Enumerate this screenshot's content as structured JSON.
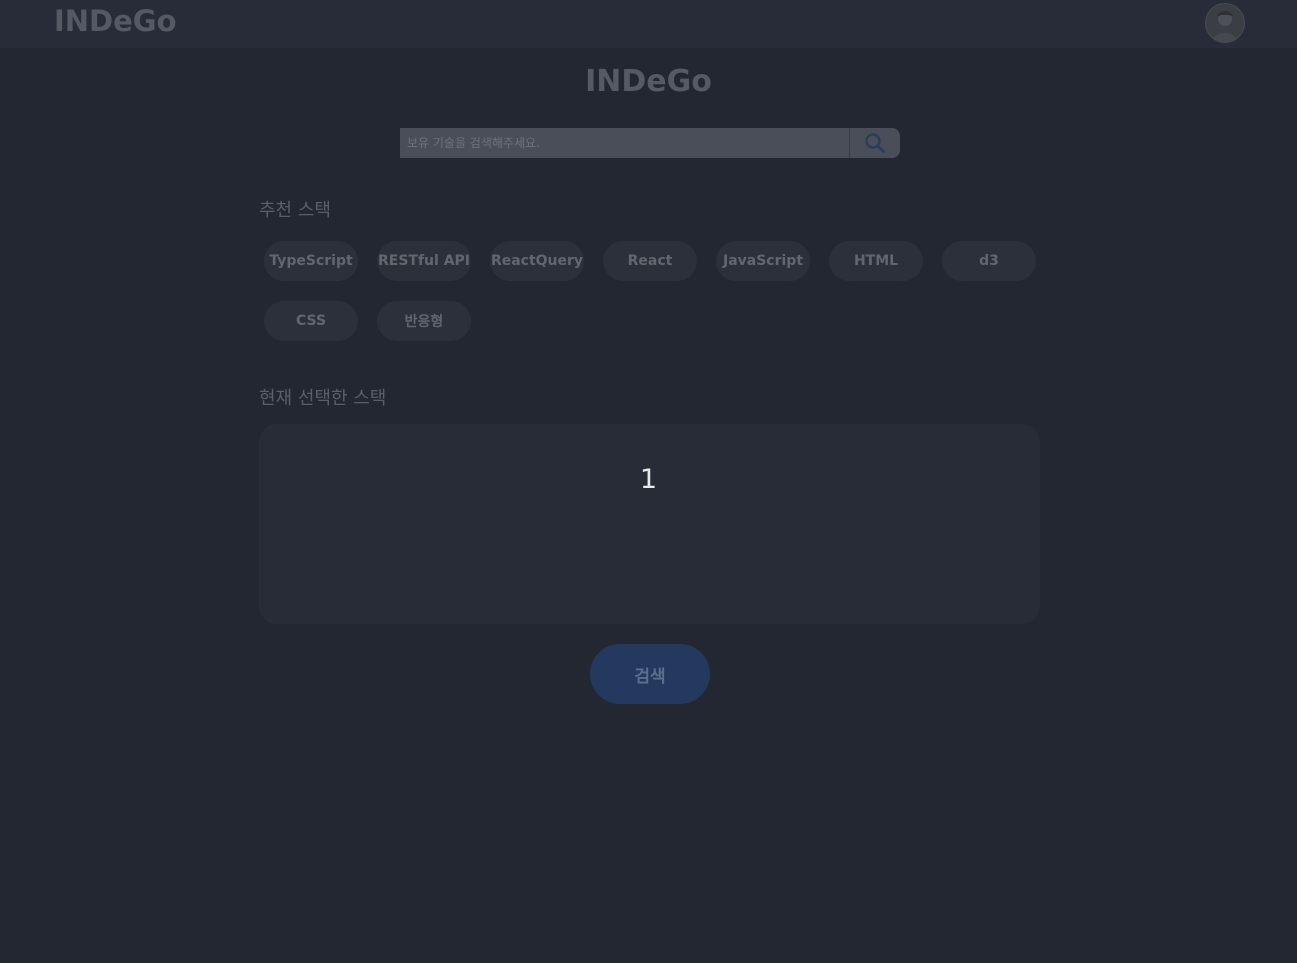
{
  "header": {
    "logo": "INDeGo"
  },
  "main": {
    "title": "INDeGo",
    "search": {
      "placeholder": "보유 기술을 검색해주세요.",
      "value": ""
    },
    "recommended": {
      "label": "추천 스택",
      "chips": [
        "TypeScript",
        "RESTful API",
        "ReactQuery",
        "React",
        "JavaScript",
        "HTML",
        "d3",
        "CSS",
        "반응형"
      ]
    },
    "selected": {
      "label": "현재 선택한 스택",
      "count": "1"
    },
    "submit_label": "검색"
  },
  "colors": {
    "background": "#222732",
    "header": "#272c38",
    "chip": "#2c303a",
    "submit": "#233a5e"
  }
}
